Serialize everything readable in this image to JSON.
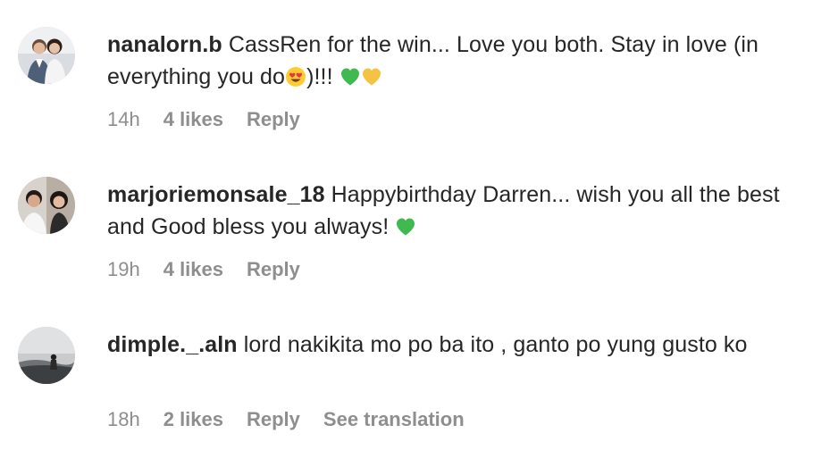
{
  "comments": [
    {
      "username": "nanalorn.b",
      "text": "CassRen for the win... Love you both. Stay in love (in everything you do",
      "text_after_emoji": ")!!! ",
      "time": "14h",
      "likes": "4 likes",
      "reply": "Reply"
    },
    {
      "username": "marjoriemonsale_18",
      "text": "Happybirthday Darren... wish you all the best and Good bless you always! ",
      "time": "19h",
      "likes": "4 likes",
      "reply": "Reply"
    },
    {
      "username": "dimple._.aln",
      "text": "lord nakikita mo po ba ito , ganto po yung gusto ko",
      "time": "18h",
      "likes": "2 likes",
      "reply": "Reply",
      "translate": "See translation"
    }
  ],
  "colors": {
    "text": "#262626",
    "meta": "#8e8e8e",
    "green_heart": "#3fb950",
    "yellow_heart": "#f5c342"
  },
  "icons": {
    "emoji_heart_eyes": "heart-eyes-emoji",
    "emoji_green_heart": "green-heart-emoji",
    "emoji_yellow_heart": "yellow-heart-emoji"
  }
}
